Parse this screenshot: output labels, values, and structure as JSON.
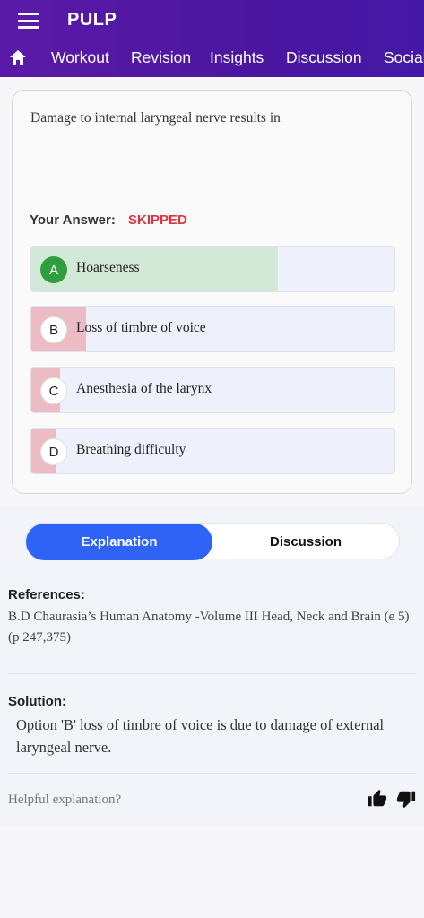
{
  "app": {
    "title": "PULP"
  },
  "nav": {
    "home_icon": "home-icon",
    "tabs": [
      {
        "label": "Workout"
      },
      {
        "label": "Revision"
      },
      {
        "label": "Insights"
      },
      {
        "label": "Discussion"
      },
      {
        "label": "Social"
      }
    ]
  },
  "question": {
    "text": "Damage to internal laryngeal nerve results in",
    "answer_label": "Your Answer:",
    "answer_value": "SKIPPED",
    "options": [
      {
        "letter": "A",
        "text": "Hoarseness",
        "percent": 68,
        "status": "correct"
      },
      {
        "letter": "B",
        "text": "Loss of timbre of voice",
        "percent": 15,
        "status": "other"
      },
      {
        "letter": "C",
        "text": "Anesthesia of the larynx",
        "percent": 8,
        "status": "other"
      },
      {
        "letter": "D",
        "text": "Breathing difficulty",
        "percent": 7,
        "status": "other"
      }
    ]
  },
  "explanation_tabs": {
    "active": "Explanation",
    "inactive": "Discussion"
  },
  "references": {
    "label": "References:",
    "text": "B.D Chaurasia’s Human Anatomy -Volume III Head, Neck and Brain (e 5) (p 247,375)"
  },
  "solution": {
    "label": "Solution:",
    "text": "Option 'B' loss of timbre of voice is due to damage of external laryngeal nerve."
  },
  "feedback": {
    "prompt": "Helpful explanation?",
    "like_icon": "thumbs-up-icon",
    "dislike_icon": "thumbs-down-icon"
  },
  "colors": {
    "header": "#5a1aa8",
    "correct_fill": "#d2e9d8",
    "correct_badge": "#2e9e3e",
    "other_fill": "#ecbcc5",
    "skipped": "#d9363e",
    "toggle_active": "#2f63f5"
  }
}
